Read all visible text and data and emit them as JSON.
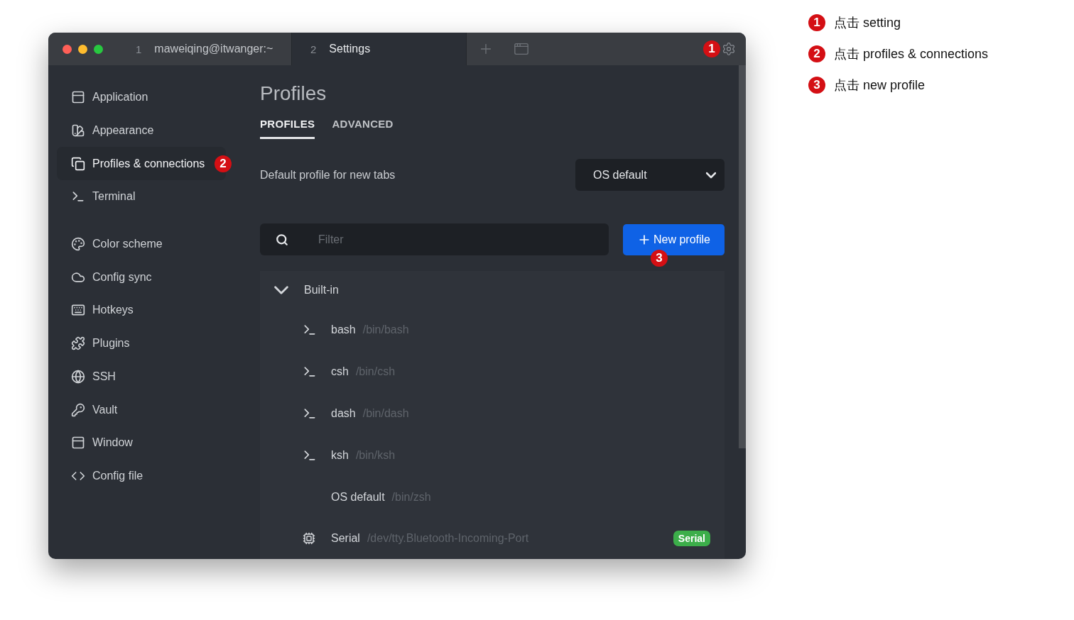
{
  "window": {
    "tabs": [
      {
        "number": "1",
        "title": "maweiqing@itwanger:~",
        "selected": false
      },
      {
        "number": "2",
        "title": "Settings",
        "selected": true
      }
    ],
    "settings_badge": "1"
  },
  "sidebar": {
    "groups": [
      [
        {
          "label": "Application",
          "selected": false
        },
        {
          "label": "Appearance",
          "selected": false
        },
        {
          "label": "Profiles & connections",
          "selected": true,
          "badge": "2"
        },
        {
          "label": "Terminal",
          "selected": false
        }
      ],
      [
        {
          "label": "Color scheme",
          "selected": false
        },
        {
          "label": "Config sync",
          "selected": false
        },
        {
          "label": "Hotkeys",
          "selected": false
        },
        {
          "label": "Plugins",
          "selected": false
        },
        {
          "label": "SSH",
          "selected": false
        },
        {
          "label": "Vault",
          "selected": false
        },
        {
          "label": "Window",
          "selected": false
        },
        {
          "label": "Config file",
          "selected": false
        }
      ]
    ]
  },
  "page": {
    "title": "Profiles",
    "tabs": [
      {
        "label": "PROFILES",
        "selected": true
      },
      {
        "label": "ADVANCED",
        "selected": false
      }
    ],
    "default_profile": {
      "label": "Default profile for new tabs",
      "value": "OS default"
    },
    "filter": {
      "placeholder": "Filter"
    },
    "new_profile_button": {
      "label": "New profile",
      "badge": "3"
    },
    "groups": [
      {
        "name": "Built-in",
        "expanded": true,
        "children": [
          {
            "name": "bash",
            "path": "/bin/bash",
            "kind": "shell"
          },
          {
            "name": "csh",
            "path": "/bin/csh",
            "kind": "shell"
          },
          {
            "name": "dash",
            "path": "/bin/dash",
            "kind": "shell"
          },
          {
            "name": "ksh",
            "path": "/bin/ksh",
            "kind": "shell"
          },
          {
            "name": "OS default",
            "path": "/bin/zsh",
            "kind": "default"
          },
          {
            "name": "Serial",
            "path": "/dev/tty.Bluetooth-Incoming-Port",
            "kind": "serial",
            "tag": "Serial"
          }
        ]
      }
    ]
  },
  "annotations": [
    {
      "number": "1",
      "text": "点击 setting"
    },
    {
      "number": "2",
      "text": "点击 profiles & connections"
    },
    {
      "number": "3",
      "text": "点击 new profile"
    }
  ]
}
